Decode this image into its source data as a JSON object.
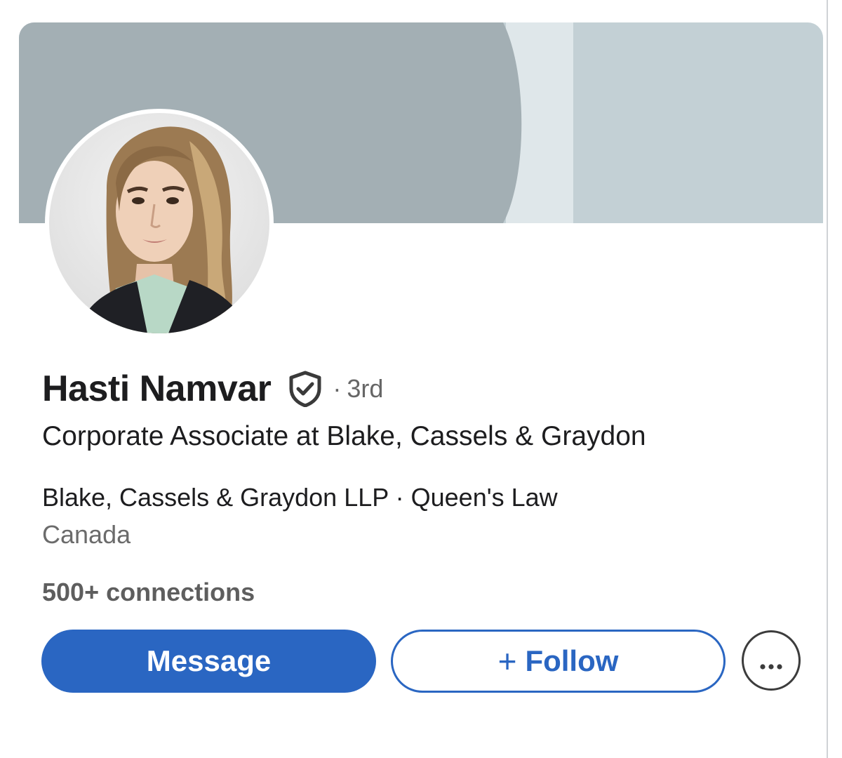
{
  "profile": {
    "name": "Hasti Namvar",
    "degree": "3rd",
    "degree_separator": "·",
    "headline": "Corporate Associate at Blake, Cassels & Graydon",
    "company": "Blake, Cassels & Graydon LLP",
    "edu_separator": "·",
    "school": "Queen's Law",
    "location": "Canada",
    "connections": "500+ connections"
  },
  "actions": {
    "message_label": "Message",
    "follow_plus": "+",
    "follow_label": "Follow",
    "more_icon": "ellipsis-icon"
  },
  "icons": {
    "verified": "verified-shield-icon"
  },
  "colors": {
    "accent": "#2a66c2",
    "banner_dark": "#a3afb4",
    "banner_light": "#c3d0d5",
    "banner_stripe": "#dfe7ea",
    "name_text": "#1d1d1f",
    "muted_text": "#6b6b6b"
  }
}
